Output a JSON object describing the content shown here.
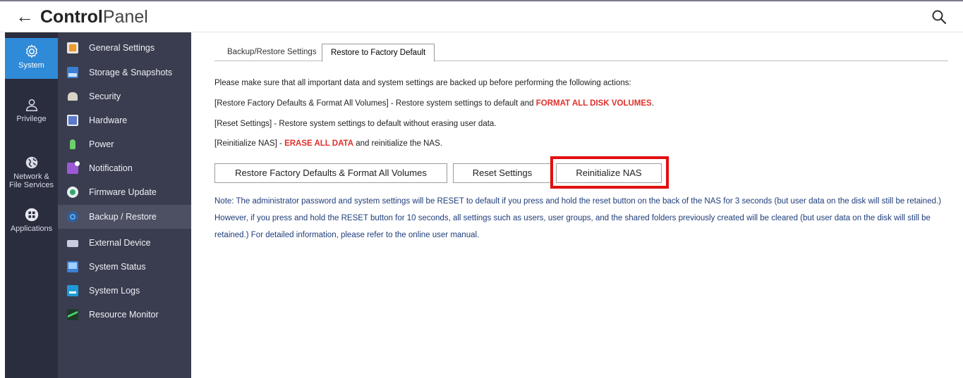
{
  "header": {
    "back_icon": "arrow-left-icon",
    "title_bold": "Control",
    "title_light": "Panel",
    "search_icon": "search-icon"
  },
  "iconbar": {
    "items": [
      {
        "label": "System",
        "icon": "gear-icon",
        "active": true
      },
      {
        "label": "Privilege",
        "icon": "user-icon",
        "active": false
      },
      {
        "label_line1": "Network &",
        "label_line2": "File Services",
        "icon": "globe-icon",
        "active": false
      },
      {
        "label": "Applications",
        "icon": "apps-icon",
        "active": false
      }
    ]
  },
  "submenu": {
    "items": [
      {
        "label": "General Settings",
        "icon": "general-settings-icon"
      },
      {
        "label": "Storage & Snapshots",
        "icon": "storage-icon"
      },
      {
        "label": "Security",
        "icon": "security-icon"
      },
      {
        "label": "Hardware",
        "icon": "hardware-icon"
      },
      {
        "label": "Power",
        "icon": "power-icon"
      },
      {
        "label": "Notification",
        "icon": "notification-icon"
      },
      {
        "label": "Firmware Update",
        "icon": "firmware-icon"
      },
      {
        "label": "Backup / Restore",
        "icon": "backup-icon",
        "active": true
      },
      {
        "label": "External Device",
        "icon": "external-device-icon"
      },
      {
        "label": "System Status",
        "icon": "system-status-icon"
      },
      {
        "label": "System Logs",
        "icon": "system-logs-icon"
      },
      {
        "label": "Resource Monitor",
        "icon": "resource-monitor-icon"
      }
    ]
  },
  "tabs": [
    {
      "label": "Backup/Restore Settings",
      "active": false
    },
    {
      "label": "Restore to Factory Default",
      "active": true
    }
  ],
  "content": {
    "intro": "Please make sure that all important data and system settings are backed up before performing the following actions:",
    "line1_prefix": "[Restore Factory Defaults & Format All Volumes] - Restore system settings to default and ",
    "line1_red": "FORMAT ALL DISK VOLUMES",
    "line1_suffix": ".",
    "line2": "[Reset Settings] - Restore system settings to default without erasing user data.",
    "line3_prefix": "[Reinitialize NAS] - ",
    "line3_red": "ERASE ALL DATA",
    "line3_suffix": " and reinitialize the NAS."
  },
  "buttons": {
    "restore_format": "Restore Factory Defaults & Format All Volumes",
    "reset": "Reset Settings",
    "reinitialize": "Reinitialize NAS"
  },
  "note": {
    "line1": "Note: The administrator password and system settings will be RESET to default if you press and hold the reset button on the back of the NAS for 3 seconds (but user data on the disk will still be retained.)",
    "line2": "However, if you press and hold the RESET button for 10 seconds, all settings such as users, user groups, and the shared folders previously created will be cleared (but user data on the disk will still be",
    "line3": "retained.) For detailed information, please refer to the online user manual."
  },
  "colors": {
    "accent": "#2f8ad8",
    "danger": "#e0302a",
    "highlight": "#e21010",
    "sidebar_dark": "#2a2d3e",
    "sidebar": "#3a3d4f",
    "note_text": "#1f3d7a"
  }
}
